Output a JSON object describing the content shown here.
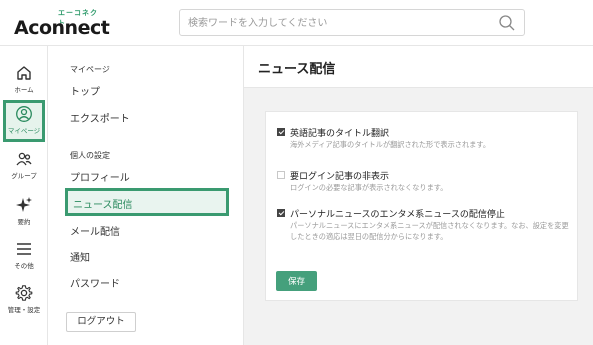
{
  "header": {
    "logo_kana": "エーコネクト",
    "logo_text": "Aconnect",
    "search_placeholder": "検索ワードを入力してください"
  },
  "rail": {
    "items": [
      {
        "label": "ホーム",
        "icon": "home-icon"
      },
      {
        "label": "マイページ",
        "icon": "user-circle-icon",
        "active": true
      },
      {
        "label": "グループ",
        "icon": "group-icon"
      },
      {
        "label": "要約",
        "icon": "sparkle-icon"
      },
      {
        "label": "その他",
        "icon": "menu-icon"
      },
      {
        "label": "管理・設定",
        "icon": "gear-icon"
      }
    ]
  },
  "menu": {
    "section1": "マイページ",
    "top": "トップ",
    "export": "エクスポート",
    "section2": "個人の設定",
    "profile": "プロフィール",
    "news": "ニュース配信",
    "mail": "メール配信",
    "notify": "通知",
    "password": "パスワード",
    "logout": "ログアウト"
  },
  "main": {
    "title": "ニュース配信",
    "options": [
      {
        "title": "英語記事のタイトル翻訳",
        "desc": "海外メディア記事のタイトルが翻訳された形で表示されます。",
        "checked": true
      },
      {
        "title": "要ログイン記事の非表示",
        "desc": "ログインの必要な記事が表示されなくなります。",
        "checked": false
      },
      {
        "title": "パーソナルニュースのエンタメ系ニュースの配信停止",
        "desc": "パーソナルニュースにエンタメ系ニュースが配信されなくなります。なお、設定を変更したときの適応は翌日の配信分からになります。",
        "checked": true
      }
    ],
    "save": "保存"
  },
  "colors": {
    "accent": "#3a9a70",
    "button": "#45a07c"
  }
}
